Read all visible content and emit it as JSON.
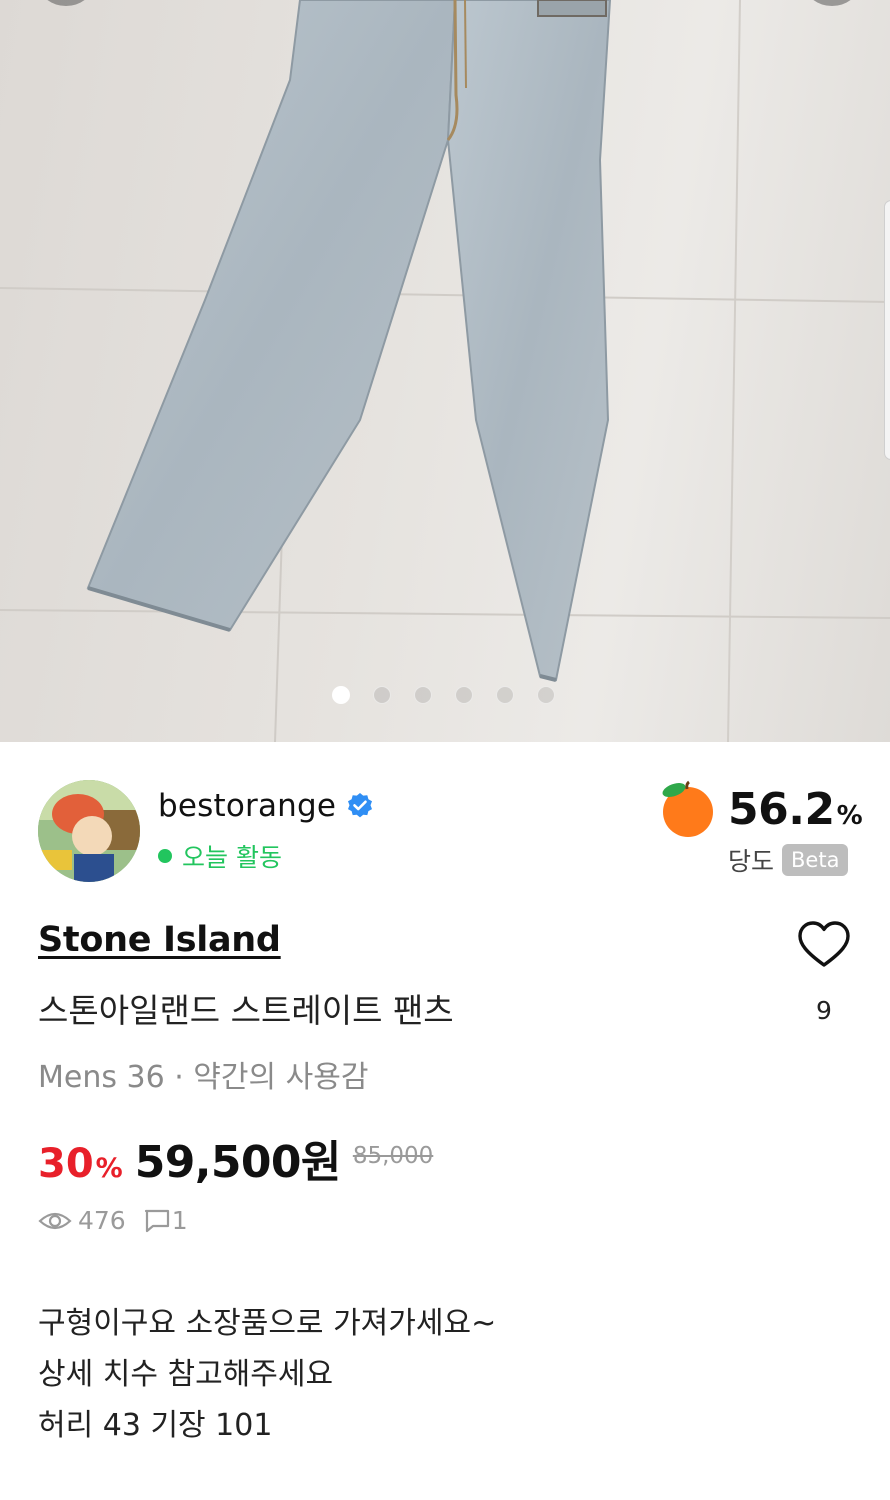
{
  "gallery": {
    "dot_count": 6,
    "active_index": 0
  },
  "seller": {
    "name": "bestorange",
    "activity": "오늘 활동"
  },
  "sweetness": {
    "value": "56.2",
    "unit": "%",
    "label": "당도",
    "badge": "Beta"
  },
  "product": {
    "brand": "Stone Island",
    "title": "스톤아일랜드 스트레이트 팬츠",
    "meta": "Mens 36 · 약간의 사용감",
    "discount": "30",
    "discount_unit": "%",
    "price": "59,500원",
    "original_price": "85,000"
  },
  "likes": {
    "count": "9"
  },
  "stats": {
    "views": "476",
    "comments": "1"
  },
  "description": {
    "lines": [
      "구형이구요 소장품으로 가져가세요~",
      "상세 치수 참고해주세요",
      "허리 43 기장 101"
    ]
  },
  "colors": {
    "accent_red": "#e8202a",
    "online_green": "#22c55e",
    "verified_blue": "#2f8ef4"
  }
}
